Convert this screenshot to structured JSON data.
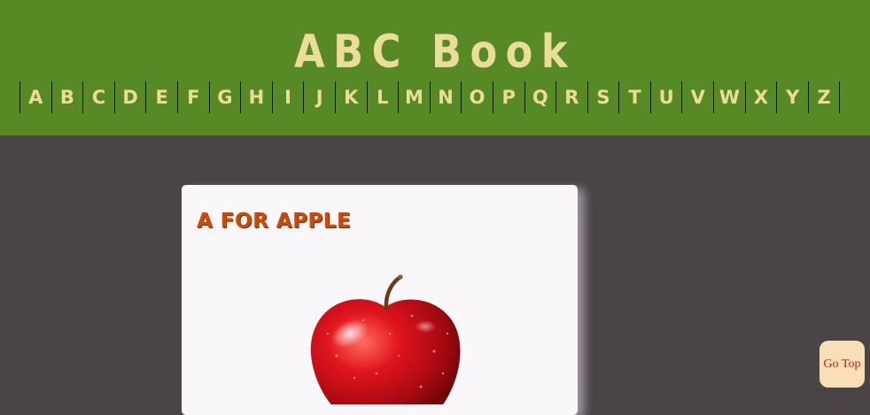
{
  "header": {
    "title": "ABC Book",
    "letters": [
      "A",
      "B",
      "C",
      "D",
      "E",
      "F",
      "G",
      "H",
      "I",
      "J",
      "K",
      "L",
      "M",
      "N",
      "O",
      "P",
      "Q",
      "R",
      "S",
      "T",
      "U",
      "V",
      "W",
      "X",
      "Y",
      "Z"
    ]
  },
  "card": {
    "title": "A FOR APPLE"
  },
  "go_top": {
    "label": "Go Top"
  },
  "colors": {
    "header_bg": "#578a24",
    "page_bg": "#4a4446",
    "title_text": "#ecdc9a",
    "card_title": "#cc4a08",
    "go_top_bg": "#f9dfb7",
    "go_top_text": "#c0211b"
  }
}
